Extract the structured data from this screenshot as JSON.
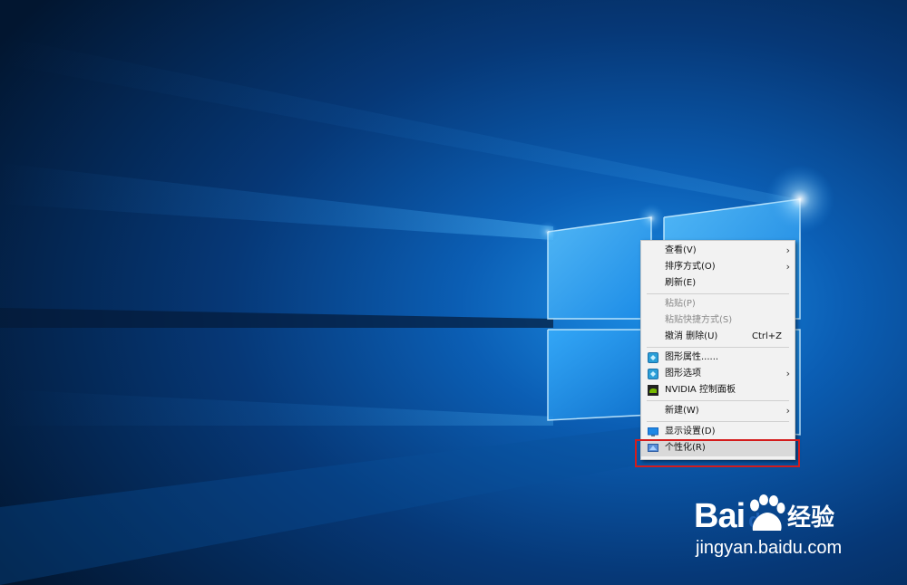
{
  "context_menu": {
    "items": [
      {
        "label": "查看(V)",
        "submenu": true,
        "enabled": true,
        "icon": null
      },
      {
        "label": "排序方式(O)",
        "submenu": true,
        "enabled": true,
        "icon": null
      },
      {
        "label": "刷新(E)",
        "submenu": false,
        "enabled": true,
        "icon": null
      },
      {
        "separator": true
      },
      {
        "label": "粘贴(P)",
        "submenu": false,
        "enabled": false,
        "icon": null
      },
      {
        "label": "粘贴快捷方式(S)",
        "submenu": false,
        "enabled": false,
        "icon": null
      },
      {
        "label": "撤消 删除(U)",
        "shortcut": "Ctrl+Z",
        "submenu": false,
        "enabled": true,
        "icon": null
      },
      {
        "separator": true
      },
      {
        "label": "图形属性......",
        "submenu": false,
        "enabled": true,
        "icon": "intel-graphics-icon"
      },
      {
        "label": "图形选项",
        "submenu": true,
        "enabled": true,
        "icon": "intel-graphics-icon"
      },
      {
        "label": "NVIDIA 控制面板",
        "submenu": false,
        "enabled": true,
        "icon": "nvidia-icon"
      },
      {
        "separator": true
      },
      {
        "label": "新建(W)",
        "submenu": true,
        "enabled": true,
        "icon": null
      },
      {
        "separator": true
      },
      {
        "label": "显示设置(D)",
        "submenu": false,
        "enabled": true,
        "icon": "display-settings-icon"
      },
      {
        "label": "个性化(R)",
        "submenu": false,
        "enabled": true,
        "icon": "personalize-icon",
        "highlighted": true
      }
    ],
    "submenu_arrow": "›"
  },
  "watermark": {
    "logo_left": "Bai",
    "logo_right": "du",
    "logo_suffix": "经验",
    "url": "jingyan.baidu.com"
  },
  "colors": {
    "highlight_box": "#d41c1c",
    "wallpaper_blue": "#0a78d7"
  }
}
